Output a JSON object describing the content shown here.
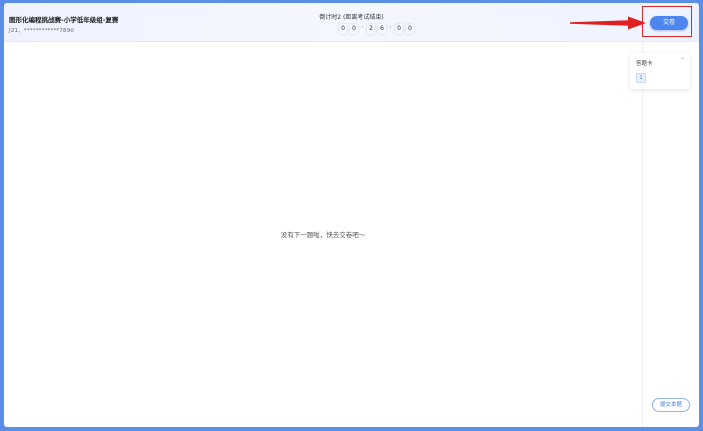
{
  "header": {
    "exam_title": "图形化编程挑战赛-小学低年级组-复赛",
    "exam_id": "J21、************7890",
    "countdown_label": "倒计时2 (距离考试结束)",
    "timer_digits": [
      "0",
      "0",
      "2",
      "6",
      "0",
      "0"
    ],
    "submit_label": "交卷"
  },
  "main": {
    "empty_message": "没有下一题啦，快去交卷吧～"
  },
  "answer_card": {
    "title": "答题卡",
    "items": [
      "1"
    ]
  },
  "footer": {
    "submit_question_label": "提交本题"
  },
  "colors": {
    "accent": "#4d86ee",
    "highlight": "#d92a2a",
    "background": "#5b8ee6"
  }
}
